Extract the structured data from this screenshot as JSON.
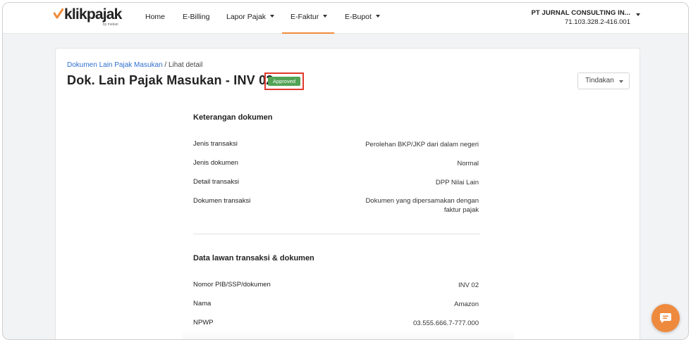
{
  "brand": {
    "name": "klikpajak",
    "sub": "by mekari",
    "accent": "#f08c3a"
  },
  "nav": {
    "items": [
      {
        "label": "Home",
        "dropdown": false
      },
      {
        "label": "E-Billing",
        "dropdown": false
      },
      {
        "label": "Lapor Pajak",
        "dropdown": true
      },
      {
        "label": "E-Faktur",
        "dropdown": true,
        "active": true
      },
      {
        "label": "E-Bupot",
        "dropdown": true
      }
    ]
  },
  "company": {
    "name": "PT JURNAL CONSULTING IN...",
    "npwp": "71.103.328.2-416.001"
  },
  "breadcrumb": {
    "parent": "Dokumen Lain Pajak Masukan",
    "separator": " / ",
    "current": "Lihat detail"
  },
  "page": {
    "title": "Dok. Lain Pajak Masukan - INV 02",
    "status": "Approved",
    "status_color": "#53a356",
    "action_label": "Tindakan"
  },
  "sections": {
    "doc_info": {
      "title": "Keterangan dokumen",
      "rows": [
        {
          "label": "Jenis transaksi",
          "value": "Perolehan BKP/JKP dari dalam negeri"
        },
        {
          "label": "Jenis dokumen",
          "value": "Normal"
        },
        {
          "label": "Detail transaksi",
          "value": "DPP Nilai Lain"
        },
        {
          "label": "Dokumen transaksi",
          "value_line1": "Dokumen yang dipersamakan dengan",
          "value_line2": "faktur pajak"
        }
      ]
    },
    "counterparty": {
      "title": "Data lawan transaksi & dokumen",
      "rows": [
        {
          "label": "Nomor PIB/SSP/dokumen",
          "value": "INV 02"
        },
        {
          "label": "Nama",
          "value": "Amazon"
        },
        {
          "label": "NPWP",
          "value": "03.555.666.7-777.000"
        }
      ]
    }
  }
}
